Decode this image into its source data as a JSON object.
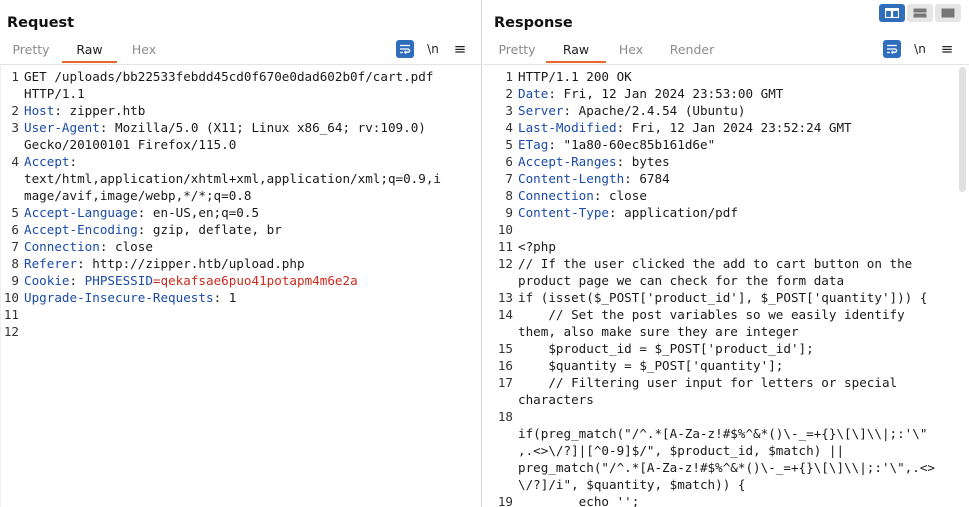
{
  "request": {
    "title": "Request",
    "tabs": [
      "Pretty",
      "Raw",
      "Hex"
    ],
    "active_tab": "Raw",
    "tools": {
      "newline_label": "\\n",
      "menu_glyph": "≡"
    },
    "lines": [
      {
        "n": "1",
        "segs": [
          {
            "t": "GET /uploads/bb22533febdd45cd0f670e0dad602b0f/cart.pdf"
          }
        ]
      },
      {
        "n": "",
        "segs": [
          {
            "t": "HTTP/1.1"
          }
        ]
      },
      {
        "n": "2",
        "segs": [
          {
            "t": "Host",
            "c": "k"
          },
          {
            "t": ": zipper.htb"
          }
        ]
      },
      {
        "n": "3",
        "segs": [
          {
            "t": "User-Agent",
            "c": "k"
          },
          {
            "t": ": Mozilla/5.0 (X11; Linux x86_64; rv:109.0)"
          }
        ]
      },
      {
        "n": "",
        "segs": [
          {
            "t": "Gecko/20100101 Firefox/115.0"
          }
        ]
      },
      {
        "n": "4",
        "segs": [
          {
            "t": "Accept",
            "c": "k"
          },
          {
            "t": ":"
          }
        ]
      },
      {
        "n": "",
        "segs": [
          {
            "t": "text/html,application/xhtml+xml,application/xml;q=0.9,i"
          }
        ]
      },
      {
        "n": "",
        "segs": [
          {
            "t": "mage/avif,image/webp,*/*;q=0.8"
          }
        ]
      },
      {
        "n": "5",
        "segs": [
          {
            "t": "Accept-Language",
            "c": "k"
          },
          {
            "t": ": en-US,en;q=0.5"
          }
        ]
      },
      {
        "n": "6",
        "segs": [
          {
            "t": "Accept-Encoding",
            "c": "k"
          },
          {
            "t": ": gzip, deflate, br"
          }
        ]
      },
      {
        "n": "7",
        "segs": [
          {
            "t": "Connection",
            "c": "k"
          },
          {
            "t": ": close"
          }
        ]
      },
      {
        "n": "8",
        "segs": [
          {
            "t": "Referer",
            "c": "k"
          },
          {
            "t": ": http://zipper.htb/upload.php"
          }
        ]
      },
      {
        "n": "9",
        "segs": [
          {
            "t": "Cookie",
            "c": "k"
          },
          {
            "t": ": "
          },
          {
            "t": "PHPSESSID",
            "c": "k"
          },
          {
            "t": "=",
            "c": "rk"
          },
          {
            "t": "qekafsae6puo41potapm4m6e2a",
            "c": "rk"
          }
        ]
      },
      {
        "n": "10",
        "segs": [
          {
            "t": "Upgrade-Insecure-Requests",
            "c": "k"
          },
          {
            "t": ": 1"
          }
        ]
      },
      {
        "n": "11",
        "segs": []
      },
      {
        "n": "12",
        "segs": []
      }
    ]
  },
  "response": {
    "title": "Response",
    "tabs": [
      "Pretty",
      "Raw",
      "Hex",
      "Render"
    ],
    "active_tab": "Raw",
    "tools": {
      "newline_label": "\\n",
      "menu_glyph": "≡"
    },
    "lines": [
      {
        "n": "1",
        "segs": [
          {
            "t": "HTTP/1.1 200 OK"
          }
        ]
      },
      {
        "n": "2",
        "segs": [
          {
            "t": "Date",
            "c": "k"
          },
          {
            "t": ": Fri, 12 Jan 2024 23:53:00 GMT"
          }
        ]
      },
      {
        "n": "3",
        "segs": [
          {
            "t": "Server",
            "c": "k"
          },
          {
            "t": ": Apache/2.4.54 (Ubuntu)"
          }
        ]
      },
      {
        "n": "4",
        "segs": [
          {
            "t": "Last-Modified",
            "c": "k"
          },
          {
            "t": ": Fri, 12 Jan 2024 23:52:24 GMT"
          }
        ]
      },
      {
        "n": "5",
        "segs": [
          {
            "t": "ETag",
            "c": "k"
          },
          {
            "t": ": \"1a80-60ec85b161d6e\""
          }
        ]
      },
      {
        "n": "6",
        "segs": [
          {
            "t": "Accept-Ranges",
            "c": "k"
          },
          {
            "t": ": bytes"
          }
        ]
      },
      {
        "n": "7",
        "segs": [
          {
            "t": "Content-Length",
            "c": "k"
          },
          {
            "t": ": 6784"
          }
        ]
      },
      {
        "n": "8",
        "segs": [
          {
            "t": "Connection",
            "c": "k"
          },
          {
            "t": ": close"
          }
        ]
      },
      {
        "n": "9",
        "segs": [
          {
            "t": "Content-Type",
            "c": "k"
          },
          {
            "t": ": application/pdf"
          }
        ]
      },
      {
        "n": "10",
        "segs": []
      },
      {
        "n": "11",
        "segs": [
          {
            "t": "<?php"
          }
        ]
      },
      {
        "n": "12",
        "segs": [
          {
            "t": "// If the user clicked the add to cart button on the"
          }
        ]
      },
      {
        "n": "",
        "segs": [
          {
            "t": "product page we can check for the form data"
          }
        ]
      },
      {
        "n": "13",
        "segs": [
          {
            "t": "if (isset($_POST['product_id'], $_POST['quantity'])) {"
          }
        ]
      },
      {
        "n": "14",
        "segs": [
          {
            "t": "    // Set the post variables so we easily identify"
          }
        ]
      },
      {
        "n": "",
        "segs": [
          {
            "t": "them, also make sure they are integer"
          }
        ]
      },
      {
        "n": "15",
        "segs": [
          {
            "t": "    $product_id = $_POST['product_id'];"
          }
        ]
      },
      {
        "n": "16",
        "segs": [
          {
            "t": "    $quantity = $_POST['quantity'];"
          }
        ]
      },
      {
        "n": "17",
        "segs": [
          {
            "t": "    // Filtering user input for letters or special"
          }
        ]
      },
      {
        "n": "",
        "segs": [
          {
            "t": "characters"
          }
        ]
      },
      {
        "n": "18",
        "segs": []
      },
      {
        "n": "",
        "segs": [
          {
            "t": "if(preg_match(\"/^.*[A-Za-z!#$%^&*()\\-_=+{}\\[\\]\\\\|;:'\\\""
          }
        ]
      },
      {
        "n": "",
        "segs": [
          {
            "t": ",.<>\\/?]|[^0-9]$/\", $product_id, $match) ||"
          }
        ]
      },
      {
        "n": "",
        "segs": [
          {
            "t": "preg_match(\"/^.*[A-Za-z!#$%^&*()\\-_=+{}\\[\\]\\\\|;:'\\\",.<>"
          }
        ]
      },
      {
        "n": "",
        "segs": [
          {
            "t": "\\/?]/i\", $quantity, $match)) {"
          }
        ]
      },
      {
        "n": "19",
        "segs": [
          {
            "t": "        echo '';"
          }
        ]
      }
    ]
  }
}
